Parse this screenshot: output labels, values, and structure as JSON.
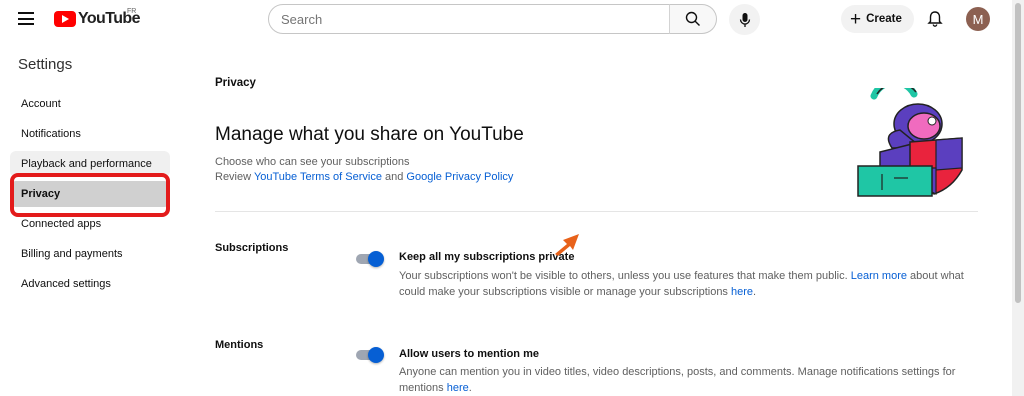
{
  "header": {
    "logo_text": "YouTube",
    "country_code": "FR",
    "search_placeholder": "Search",
    "create_label": "Create",
    "avatar_letter": "M"
  },
  "sidebar": {
    "title": "Settings",
    "items": [
      {
        "label": "Account"
      },
      {
        "label": "Notifications"
      },
      {
        "label": "Playback and performance"
      },
      {
        "label": "Privacy"
      },
      {
        "label": "Connected apps"
      },
      {
        "label": "Billing and payments"
      },
      {
        "label": "Advanced settings"
      }
    ],
    "active_item": "Privacy"
  },
  "main": {
    "section": "Privacy",
    "title": "Manage what you share on YouTube",
    "subtitle": "Choose who can see your subscriptions",
    "review_prefix": "Review ",
    "terms_link": "YouTube Terms of Service",
    "review_and": " and ",
    "policy_link": "Google Privacy Policy",
    "subscriptions": {
      "label": "Subscriptions",
      "option_title": "Keep all my subscriptions private",
      "toggle_on": true,
      "desc_1": "Your subscriptions won't be visible to others, unless you use features that make them public. ",
      "learn_more": "Learn more",
      "desc_2": " about what could make your subscriptions visible or manage your subscriptions ",
      "here": "here",
      "desc_end": "."
    },
    "mentions": {
      "label": "Mentions",
      "option_title": "Allow users to mention me",
      "toggle_on": true,
      "desc_1": "Anyone can mention you in video titles, video descriptions, posts, and comments. Manage notifications settings for mentions ",
      "here": "here",
      "desc_end": "."
    }
  },
  "colors": {
    "brand_red": "#ff0000",
    "link_blue": "#065fd4",
    "highlight_box": "#e31b1b",
    "annotation_arrow": "#e8621a"
  }
}
